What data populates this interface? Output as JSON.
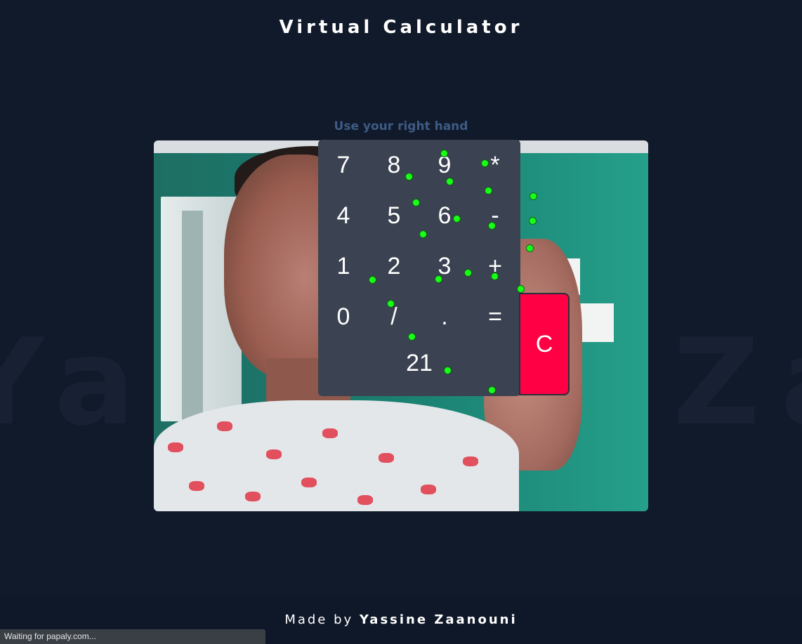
{
  "header": {
    "title": "Virtual Calculator"
  },
  "instruction": "Use your right hand",
  "watermark": "Yassine Zaanouni",
  "calculator": {
    "keys": [
      [
        "7",
        "8",
        "9",
        "*"
      ],
      [
        "4",
        "5",
        "6",
        "-"
      ],
      [
        "1",
        "2",
        "3",
        "+"
      ],
      [
        "0",
        "/",
        ".",
        "="
      ]
    ],
    "display": "21",
    "clear_label": "C"
  },
  "footer": {
    "made_by": "Made by",
    "author": "Yassine Zaanouni"
  },
  "status": "Waiting for papaly.com...",
  "colors": {
    "background": "#111a2a",
    "calculator_bg": "#3b4251",
    "clear_button": "#ff0044",
    "landmark": "#19ff19",
    "instruction": "#3e5b85"
  }
}
